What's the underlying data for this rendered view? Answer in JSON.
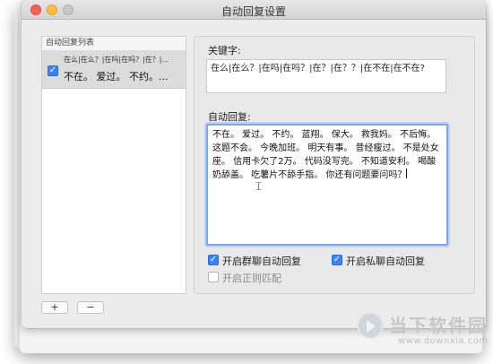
{
  "window": {
    "title": "自动回复设置"
  },
  "list": {
    "header": "自动回复列表",
    "items": [
      {
        "checked": true,
        "keyword": "在么|在么？|在吗|在吗？|在？|...",
        "reply": "不在。 爱过。 不约。..."
      }
    ],
    "add_label": "+",
    "remove_label": "−"
  },
  "editor": {
    "keyword_label": "关键字:",
    "keyword_value": "在么|在么？|在吗|在吗？|在？|在？？|在不在|在不在?",
    "reply_label": "自动回复:",
    "reply_value": "不在。 爱过。 不约。 蓝翔。 保大。 救我妈。 不后悔。 这题不会。 今晚加班。 明天有事。 昔经瘦过。 不是处女座。 信用卡欠了2万。 代码没写完。 不知道安利。 喝酸奶舔盖。 吃薯片不舔手指。 你还有问题要问吗？"
  },
  "options": {
    "group_reply": {
      "label": "开启群聊自动回复",
      "checked": true
    },
    "private_reply": {
      "label": "开启私聊自动回复",
      "checked": true
    },
    "regex_match": {
      "label": "开启正则匹配",
      "checked": false
    }
  },
  "watermark": {
    "brand": "当下软件园",
    "url": "www.downxia.com"
  },
  "colors": {
    "accent": "#3b82f6",
    "focus_ring": "#79a8f0",
    "close": "#fc605c",
    "minimize": "#fdbc40"
  }
}
